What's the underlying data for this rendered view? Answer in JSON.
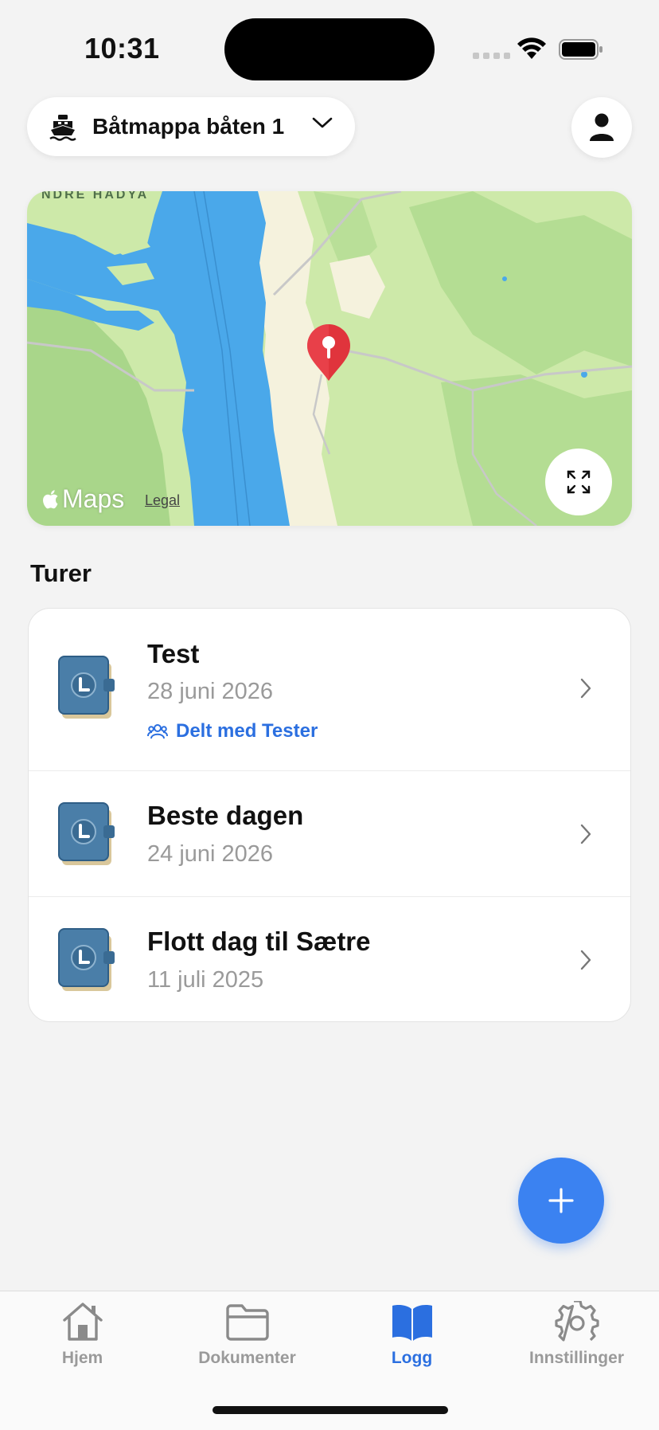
{
  "status_bar": {
    "time": "10:31"
  },
  "header": {
    "boat_selector_label": "Båtmappa båten 1",
    "boat_icon": "boat-icon",
    "profile_icon": "person-icon"
  },
  "map": {
    "area_label": "NDRE HADYA",
    "maps_brand": "Maps",
    "legal_label": "Legal",
    "expand_icon": "expand-icon",
    "pin_icon": "map-pin-icon"
  },
  "trips": {
    "section_title": "Turer",
    "items": [
      {
        "title": "Test",
        "date": "28 juni 2026",
        "shared_label": "Delt med Tester"
      },
      {
        "title": "Beste dagen",
        "date": "24 juni 2026"
      },
      {
        "title": "Flott dag til Sætre",
        "date": "11 juli 2025"
      }
    ]
  },
  "fab": {
    "icon": "plus-icon"
  },
  "tab_bar": {
    "tabs": [
      {
        "label": "Hjem",
        "icon": "home-icon",
        "active": false
      },
      {
        "label": "Dokumenter",
        "icon": "folder-icon",
        "active": false
      },
      {
        "label": "Logg",
        "icon": "book-open-icon",
        "active": true
      },
      {
        "label": "Innstillinger",
        "icon": "gear-icon",
        "active": false
      }
    ]
  },
  "colors": {
    "accent": "#3b82f1",
    "link": "#2b6fe0",
    "water": "#4aa8ea",
    "land": "#cde9a9",
    "pin": "#e0343c"
  }
}
